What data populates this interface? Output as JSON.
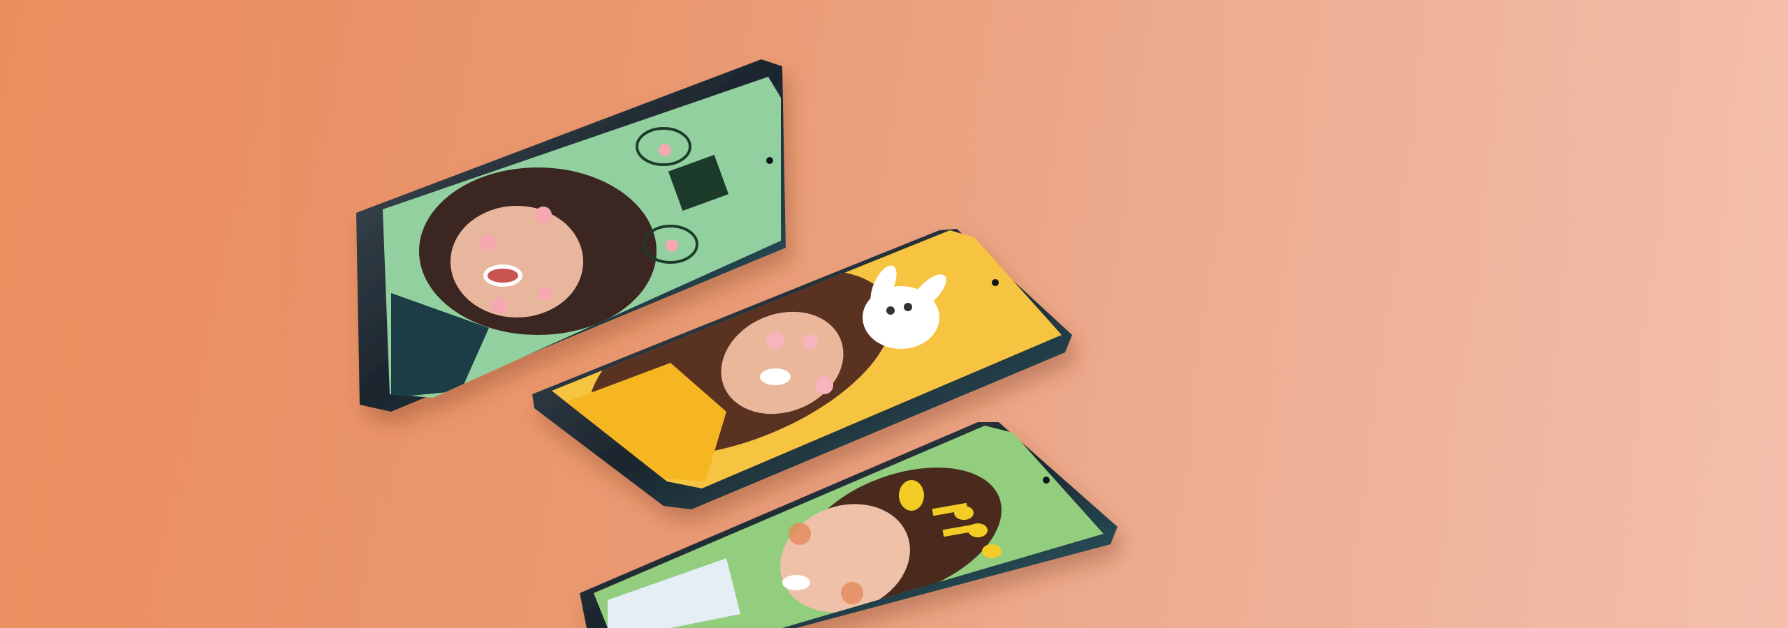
{
  "scene": {
    "description_free": true,
    "background_color_left": "#ec8d5f",
    "background_color_right": "#f3bba6",
    "phones": [
      {
        "screen_color": "#93d0a0",
        "subject_icon": "woman-with-cat-ear-doodle-filter"
      },
      {
        "screen_color": "#f6c43f",
        "subject_icon": "woman-with-bunny-filter"
      },
      {
        "screen_color": "#93ce7f",
        "subject_icon": "woman-with-giraffe-filter"
      }
    ],
    "frame_color": "#1f2a33",
    "accent_frame_color": "#2f6a78"
  }
}
